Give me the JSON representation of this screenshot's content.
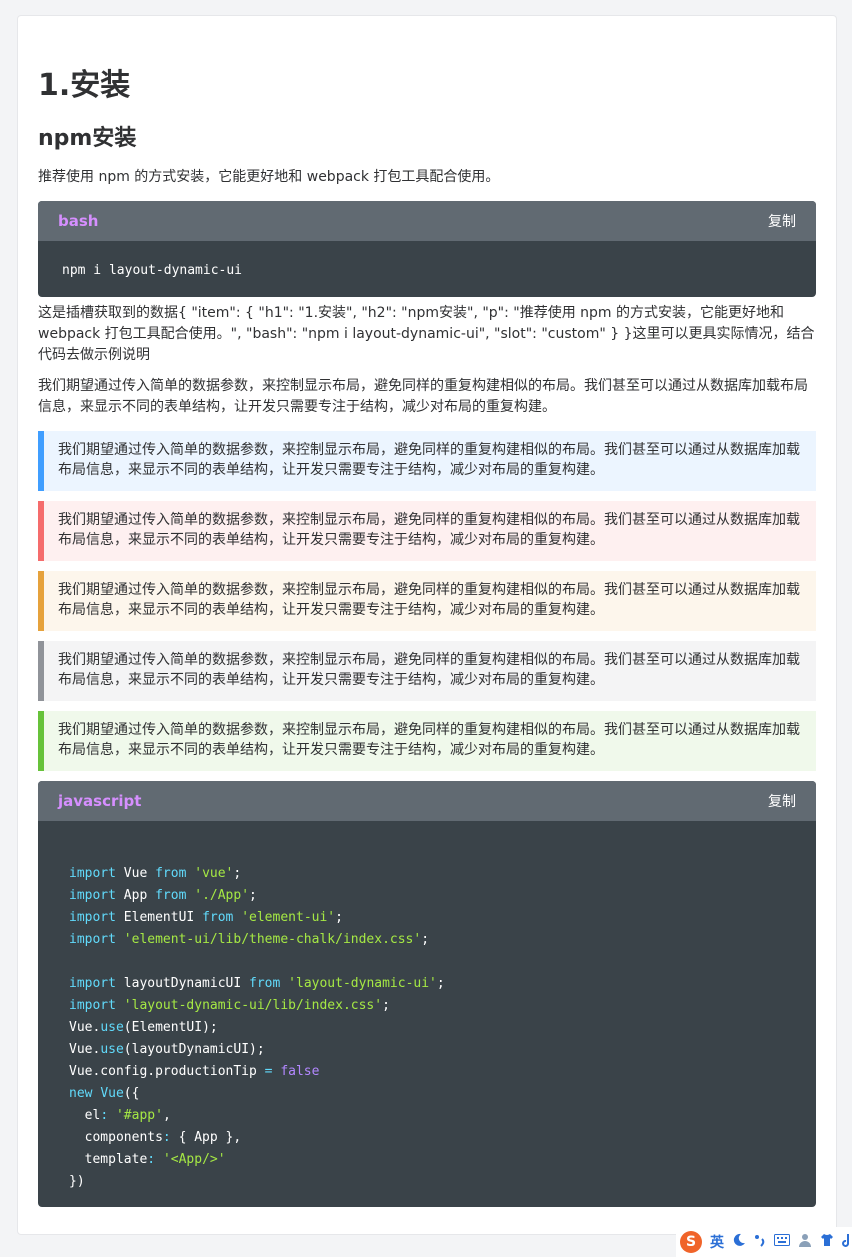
{
  "heading1": "1.安装",
  "heading2": "npm安装",
  "intro": "推荐使用 npm 的方式安装，它能更好地和 webpack 打包工具配合使用。",
  "bash_block": {
    "lang": "bash",
    "copy_label": "复制",
    "code": "npm i layout-dynamic-ui"
  },
  "note_data": "这是插槽获取到的数据{ \"item\": { \"h1\": \"1.安装\", \"h2\": \"npm安装\", \"p\": \"推荐使用 npm 的方式安装，它能更好地和 webpack 打包工具配合使用。\", \"bash\": \"npm i layout-dynamic-ui\", \"slot\": \"custom\" } }这里可以更具实际情况，结合代码去做示例说明",
  "note_desc": "我们期望通过传入简单的数据参数，来控制显示布局，避免同样的重复构建相似的布局。我们甚至可以通过从数据库加载布局信息，来显示不同的表单结构，让开发只需要专注于结构，减少对布局的重复构建。",
  "callouts": {
    "blue": "我们期望通过传入简单的数据参数，来控制显示布局，避免同样的重复构建相似的布局。我们甚至可以通过从数据库加载布局信息，来显示不同的表单结构，让开发只需要专注于结构，减少对布局的重复构建。",
    "red": "我们期望通过传入简单的数据参数，来控制显示布局，避免同样的重复构建相似的布局。我们甚至可以通过从数据库加载布局信息，来显示不同的表单结构，让开发只需要专注于结构，减少对布局的重复构建。",
    "orange": "我们期望通过传入简单的数据参数，来控制显示布局，避免同样的重复构建相似的布局。我们甚至可以通过从数据库加载布局信息，来显示不同的表单结构，让开发只需要专注于结构，减少对布局的重复构建。",
    "gray": "我们期望通过传入简单的数据参数，来控制显示布局，避免同样的重复构建相似的布局。我们甚至可以通过从数据库加载布局信息，来显示不同的表单结构，让开发只需要专注于结构，减少对布局的重复构建。",
    "green": "我们期望通过传入简单的数据参数，来控制显示布局，避免同样的重复构建相似的布局。我们甚至可以通过从数据库加载布局信息，来显示不同的表单结构，让开发只需要专注于结构，减少对布局的重复构建。"
  },
  "callout_colors": {
    "blue": "#409eff",
    "red": "#f56c6c",
    "orange": "#e6a23c",
    "gray": "#909399",
    "green": "#67c23a"
  },
  "js_block": {
    "lang": "javascript",
    "copy_label": "复制",
    "lines": [
      [
        [
          "kw",
          "import"
        ],
        [
          "t",
          " Vue "
        ],
        [
          "kw",
          "from"
        ],
        [
          "t",
          " "
        ],
        [
          "str",
          "'vue'"
        ],
        [
          "t",
          ";"
        ]
      ],
      [
        [
          "kw",
          "import"
        ],
        [
          "t",
          " App "
        ],
        [
          "kw",
          "from"
        ],
        [
          "t",
          " "
        ],
        [
          "str",
          "'./App'"
        ],
        [
          "t",
          ";"
        ]
      ],
      [
        [
          "kw",
          "import"
        ],
        [
          "t",
          " ElementUI "
        ],
        [
          "kw",
          "from"
        ],
        [
          "t",
          " "
        ],
        [
          "str",
          "'element-ui'"
        ],
        [
          "t",
          ";"
        ]
      ],
      [
        [
          "kw",
          "import"
        ],
        [
          "t",
          " "
        ],
        [
          "str",
          "'element-ui/lib/theme-chalk/index.css'"
        ],
        [
          "t",
          ";"
        ]
      ],
      [
        [
          "t",
          ""
        ]
      ],
      [
        [
          "kw",
          "import"
        ],
        [
          "t",
          " layoutDynamicUI "
        ],
        [
          "kw",
          "from"
        ],
        [
          "t",
          " "
        ],
        [
          "str",
          "'layout-dynamic-ui'"
        ],
        [
          "t",
          ";"
        ]
      ],
      [
        [
          "kw",
          "import"
        ],
        [
          "t",
          " "
        ],
        [
          "str",
          "'layout-dynamic-ui/lib/index.css'"
        ],
        [
          "t",
          ";"
        ]
      ],
      [
        [
          "t",
          "Vue."
        ],
        [
          "fn",
          "use"
        ],
        [
          "t",
          "(ElementUI);"
        ]
      ],
      [
        [
          "t",
          "Vue."
        ],
        [
          "fn",
          "use"
        ],
        [
          "t",
          "(layoutDynamicUI);"
        ]
      ],
      [
        [
          "t",
          "Vue.config.productionTip "
        ],
        [
          "op",
          "="
        ],
        [
          "t",
          " "
        ],
        [
          "bool",
          "false"
        ]
      ],
      [
        [
          "kw",
          "new"
        ],
        [
          "t",
          " "
        ],
        [
          "fn",
          "Vue"
        ],
        [
          "t",
          "({"
        ]
      ],
      [
        [
          "t",
          "  el"
        ],
        [
          "op",
          ":"
        ],
        [
          "t",
          " "
        ],
        [
          "str",
          "'#app'"
        ],
        [
          "t",
          ","
        ]
      ],
      [
        [
          "t",
          "  components"
        ],
        [
          "op",
          ":"
        ],
        [
          "t",
          " { App },"
        ]
      ],
      [
        [
          "t",
          "  template"
        ],
        [
          "op",
          ":"
        ],
        [
          "t",
          " "
        ],
        [
          "str",
          "'<App/>'"
        ]
      ],
      [
        [
          "t",
          "})"
        ]
      ]
    ]
  },
  "tray": {
    "ime_logo": "S",
    "ime_mode": "英",
    "icons": [
      "moon-icon",
      "punctuation-icon",
      "keyboard-icon",
      "user-icon",
      "shirt-icon",
      "more-icon"
    ]
  }
}
